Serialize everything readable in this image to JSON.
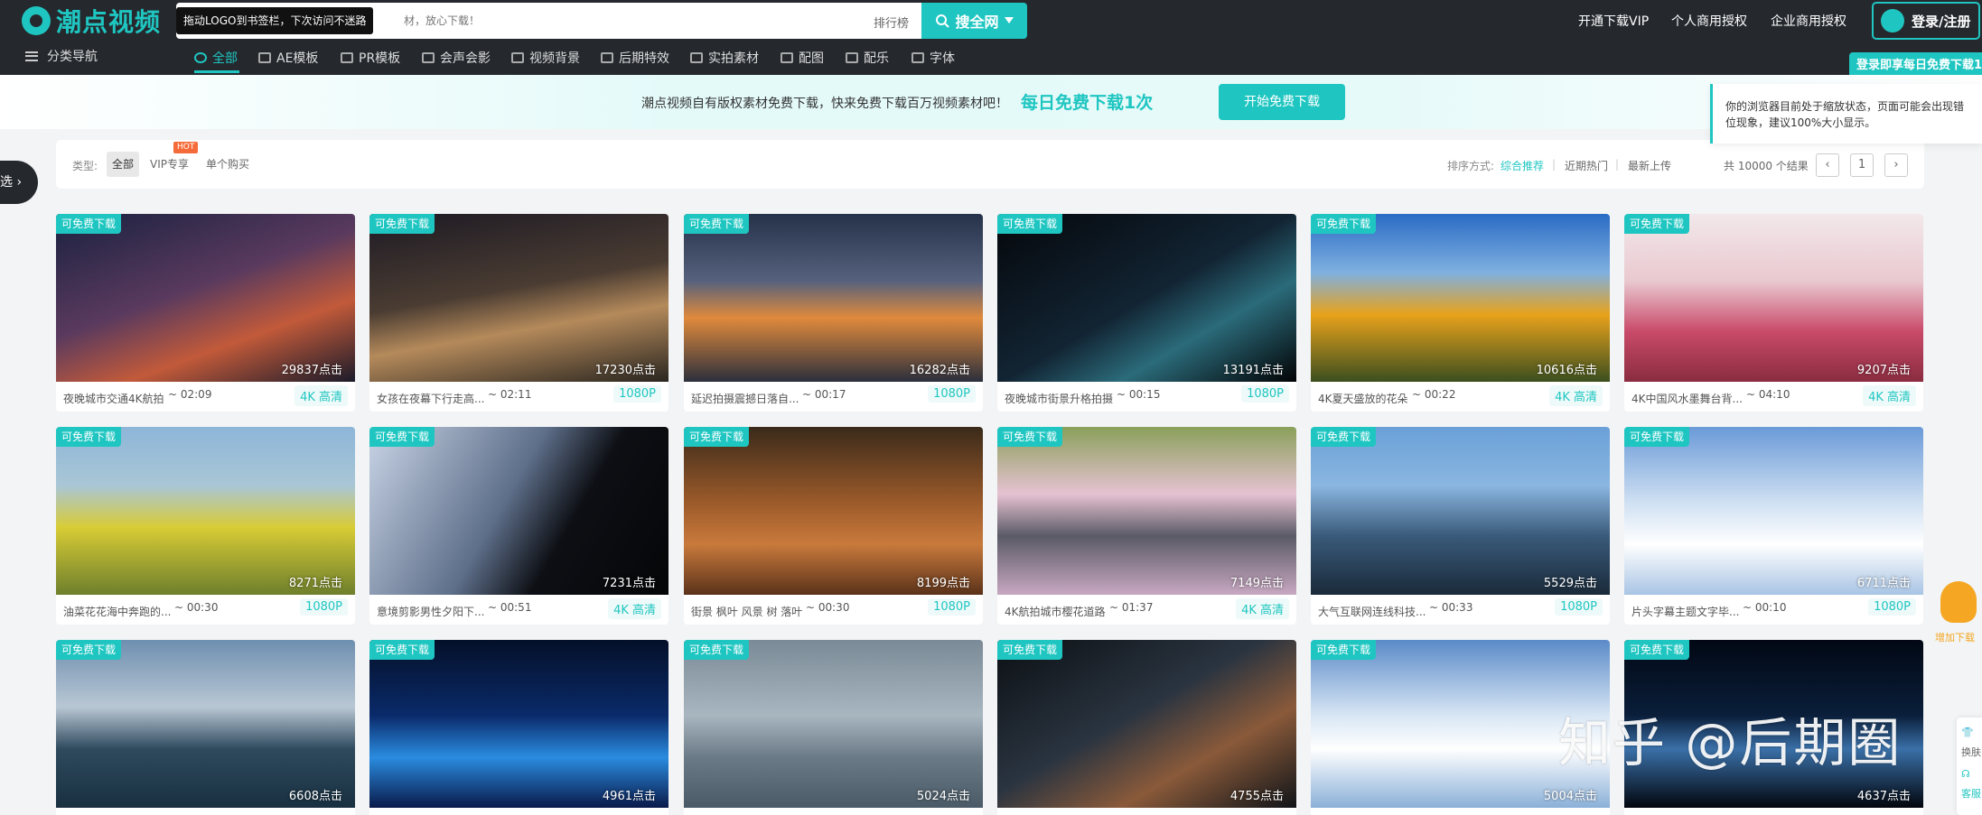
{
  "header": {
    "logo_text": "潮点视频",
    "drag_tip": "拖动LOGO到书签栏，下次访问不迷路",
    "search_placeholder": "材，放心下载！",
    "rank_label": "排行榜",
    "search_button": "搜全网",
    "links": [
      "开通下载VIP",
      "个人商用授权",
      "企业商用授权"
    ],
    "login_button": "登录/注册",
    "login_tip": "登录即享每日免费下载1次",
    "nav_label": "分类导航",
    "nav_items": [
      "全部",
      "AE模板",
      "PR模板",
      "会声会影",
      "视频背景",
      "后期特效",
      "实拍素材",
      "配图",
      "配乐",
      "字体"
    ]
  },
  "banner": {
    "text": "潮点视频自有版权素材免费下载，快来免费下载百万视频素材吧！",
    "highlight": "每日免费下载1次",
    "button": "开始免费下载"
  },
  "browser_warning": "你的浏览器目前处于缩放状态，页面可能会出现错位现象，建议100%大小显示。",
  "filter_button": "选",
  "filter": {
    "type_label": "类型:",
    "types": [
      "全部",
      "VIP专享",
      "单个购买"
    ],
    "hot_badge": "HOT",
    "sort_label": "排序方式:",
    "sorts": [
      "综合推荐",
      "近期热门",
      "最新上传"
    ],
    "total": "共 10000 个结果",
    "page": "1"
  },
  "free_tag": "可免费下载",
  "cards": [
    {
      "title": "夜晚城市交通4K航拍",
      "duration": "02:09",
      "quality": "4K 高清",
      "clicks": "29837点击"
    },
    {
      "title": "女孩在夜幕下行走高...",
      "duration": "02:11",
      "quality": "1080P",
      "clicks": "17230点击"
    },
    {
      "title": "延迟拍摄震撼日落自...",
      "duration": "00:17",
      "quality": "1080P",
      "clicks": "16282点击"
    },
    {
      "title": "夜晚城市街景升格拍摄",
      "duration": "00:15",
      "quality": "1080P",
      "clicks": "13191点击"
    },
    {
      "title": "4K夏天盛放的花朵",
      "duration": "00:22",
      "quality": "4K 高清",
      "clicks": "10616点击"
    },
    {
      "title": "4K中国风水墨舞台背...",
      "duration": "04:10",
      "quality": "4K 高清",
      "clicks": "9207点击"
    },
    {
      "title": "油菜花花海中奔跑的...",
      "duration": "00:30",
      "quality": "1080P",
      "clicks": "8271点击"
    },
    {
      "title": "意境剪影男性夕阳下...",
      "duration": "00:51",
      "quality": "4K 高清",
      "clicks": "7231点击"
    },
    {
      "title": "街景 枫叶 风景 树 落叶",
      "duration": "00:30",
      "quality": "1080P",
      "clicks": "8199点击"
    },
    {
      "title": "4K航拍城市樱花道路",
      "duration": "01:37",
      "quality": "4K 高清",
      "clicks": "7149点击"
    },
    {
      "title": "大气互联网连线科技...",
      "duration": "00:33",
      "quality": "1080P",
      "clicks": "5529点击"
    },
    {
      "title": "片头字幕主题文字毕...",
      "duration": "00:10",
      "quality": "1080P",
      "clicks": "6711点击"
    },
    {
      "title": "",
      "duration": "",
      "quality": "",
      "clicks": "6608点击"
    },
    {
      "title": "",
      "duration": "",
      "quality": "",
      "clicks": "4961点击"
    },
    {
      "title": "",
      "duration": "",
      "quality": "",
      "clicks": "5024点击"
    },
    {
      "title": "",
      "duration": "",
      "quality": "",
      "clicks": "4755点击"
    },
    {
      "title": "",
      "duration": "",
      "quality": "",
      "clicks": "5004点击"
    },
    {
      "title": "",
      "duration": "",
      "quality": "",
      "clicks": "4637点击"
    }
  ],
  "watermark": "知乎 @后期圈",
  "side_fab": "增加下载",
  "side_tools": [
    "换肤",
    "客服"
  ]
}
